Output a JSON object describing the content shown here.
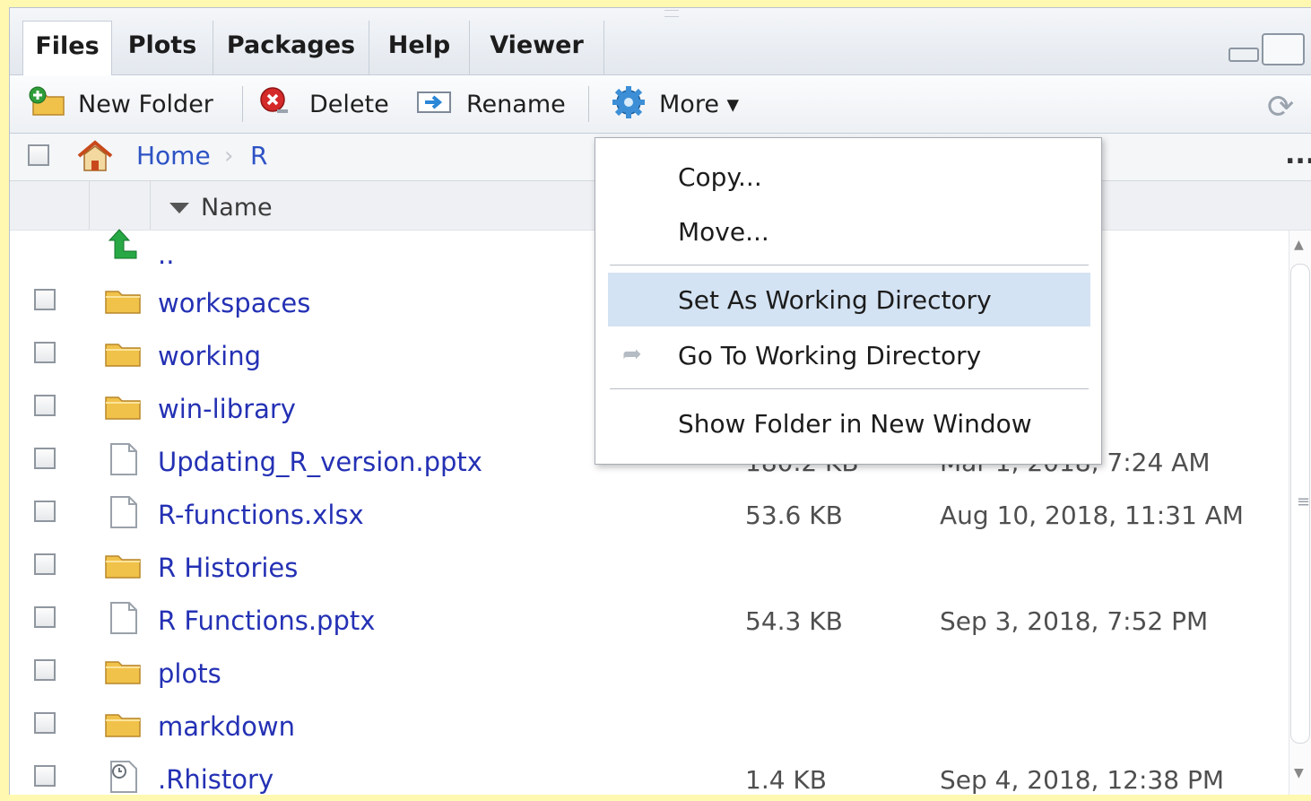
{
  "tabs": [
    {
      "label": "Files"
    },
    {
      "label": "Plots"
    },
    {
      "label": "Packages"
    },
    {
      "label": "Help"
    },
    {
      "label": "Viewer"
    }
  ],
  "toolbar": {
    "new_folder": "New Folder",
    "delete": "Delete",
    "rename": "Rename",
    "more": "More ▾"
  },
  "breadcrumb": {
    "home": "Home",
    "separator": "›",
    "folder": "R",
    "overflow": "..."
  },
  "header": {
    "name": "Name"
  },
  "rows": [
    {
      "name": "..",
      "type": "up",
      "size": "",
      "modified": ""
    },
    {
      "name": "workspaces",
      "type": "folder",
      "size": "",
      "modified": ""
    },
    {
      "name": "working",
      "type": "folder",
      "size": "",
      "modified": ""
    },
    {
      "name": "win-library",
      "type": "folder",
      "size": "",
      "modified": ""
    },
    {
      "name": "Updating_R_version.pptx",
      "type": "file",
      "size": "180.2 KB",
      "modified": "Mar 1, 2018, 7:24 AM"
    },
    {
      "name": "R-functions.xlsx",
      "type": "file",
      "size": "53.6 KB",
      "modified": "Aug 10, 2018, 11:31 AM"
    },
    {
      "name": "R Histories",
      "type": "folder",
      "size": "",
      "modified": ""
    },
    {
      "name": "R Functions.pptx",
      "type": "file",
      "size": "54.3 KB",
      "modified": "Sep 3, 2018, 7:52 PM"
    },
    {
      "name": "plots",
      "type": "folder",
      "size": "",
      "modified": ""
    },
    {
      "name": "markdown",
      "type": "folder",
      "size": "",
      "modified": ""
    },
    {
      "name": ".Rhistory",
      "type": "history",
      "size": "1.4 KB",
      "modified": "Sep 4, 2018, 12:38 PM"
    }
  ],
  "more_menu": {
    "copy": "Copy...",
    "move": "Move...",
    "set_wd": "Set As Working Directory",
    "go_wd": "Go To Working Directory",
    "show_folder": "Show Folder in New Window"
  },
  "colors": {
    "link": "#2431b4",
    "menu_highlight": "#d4e3f3",
    "background_highlight": "#fff8b0"
  }
}
